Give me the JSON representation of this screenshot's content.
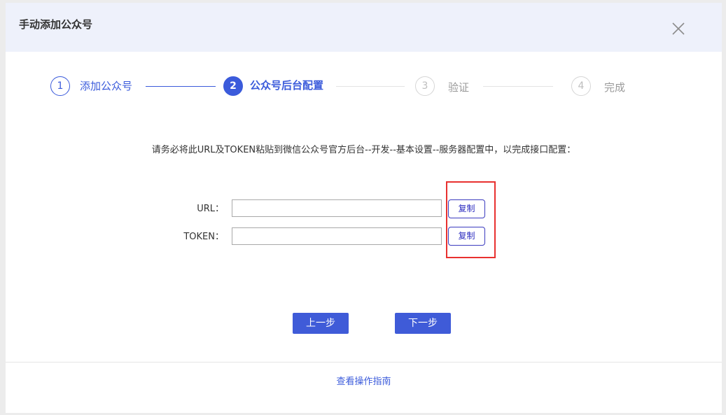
{
  "dialog": {
    "title": "手动添加公众号",
    "close_icon": "close-icon"
  },
  "steps": [
    {
      "number": "1",
      "label": "添加公众号",
      "state": "done"
    },
    {
      "number": "2",
      "label": "公众号后台配置",
      "state": "active"
    },
    {
      "number": "3",
      "label": "验证",
      "state": "todo"
    },
    {
      "number": "4",
      "label": "完成",
      "state": "todo"
    }
  ],
  "instruction": "请务必将此URL及TOKEN粘贴到微信公众号官方后台--开发--基本设置--服务器配置中，以完成接口配置：",
  "fields": {
    "url": {
      "label": "URL：",
      "value": "",
      "copy_label": "复制"
    },
    "token": {
      "label": "TOKEN：",
      "value": "",
      "copy_label": "复制"
    }
  },
  "buttons": {
    "prev_label": "上一步",
    "next_label": "下一步"
  },
  "footer": {
    "guide_link": "查看操作指南"
  },
  "colors": {
    "accent": "#3b5bdb",
    "highlight": "#e8312f",
    "header_bg": "#eef1fb"
  }
}
